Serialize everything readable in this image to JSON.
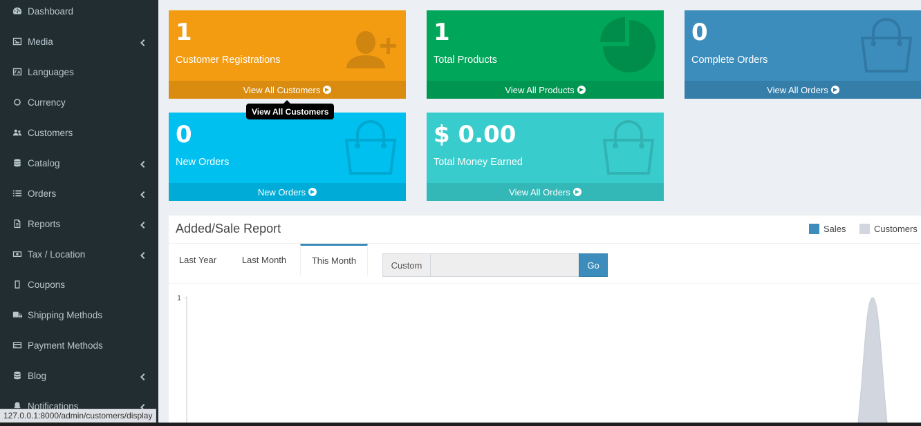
{
  "sidebar": {
    "items": [
      {
        "label": "Dashboard",
        "icon": "dashboard-icon",
        "has_submenu": false
      },
      {
        "label": "Media",
        "icon": "image-icon",
        "has_submenu": true
      },
      {
        "label": "Languages",
        "icon": "language-icon",
        "has_submenu": false
      },
      {
        "label": "Currency",
        "icon": "circle-icon",
        "has_submenu": false
      },
      {
        "label": "Customers",
        "icon": "users-icon",
        "has_submenu": false
      },
      {
        "label": "Catalog",
        "icon": "database-icon",
        "has_submenu": true
      },
      {
        "label": "Orders",
        "icon": "list-icon",
        "has_submenu": true
      },
      {
        "label": "Reports",
        "icon": "file-icon",
        "has_submenu": true
      },
      {
        "label": "Tax / Location",
        "icon": "money-icon",
        "has_submenu": true
      },
      {
        "label": "Coupons",
        "icon": "tablet-icon",
        "has_submenu": false
      },
      {
        "label": "Shipping Methods",
        "icon": "truck-icon",
        "has_submenu": false
      },
      {
        "label": "Payment Methods",
        "icon": "credit-card-icon",
        "has_submenu": false
      },
      {
        "label": "Blog",
        "icon": "database-icon",
        "has_submenu": true
      },
      {
        "label": "Notifications",
        "icon": "bell-icon",
        "has_submenu": true
      }
    ]
  },
  "tiles": [
    {
      "value": "1",
      "caption": "Customer Registrations",
      "link": "View All Customers",
      "color": "#f39c12",
      "icon": "user-plus-icon"
    },
    {
      "value": "1",
      "caption": "Total Products",
      "link": "View All Products",
      "color": "#00a65a",
      "icon": "pie-chart-icon"
    },
    {
      "value": "0",
      "caption": "Complete Orders",
      "link": "View All Orders",
      "color": "#3c8dbc",
      "icon": "shopping-bag-icon"
    },
    {
      "value": "0",
      "caption": "New Orders",
      "link": "New Orders",
      "color": "#00c0ef",
      "icon": "shopping-bag-icon"
    },
    {
      "value": "$ 0.00",
      "caption": "Total Money Earned",
      "link": "View All Orders",
      "color": "#39cccc",
      "icon": "shopping-bag-icon"
    }
  ],
  "tooltip": "View All Customers",
  "report": {
    "title": "Added/Sale Report",
    "legend": [
      {
        "label": "Sales",
        "color": "#3c8dbc"
      },
      {
        "label": "Customers",
        "color": "#d2d6de"
      }
    ],
    "tabs": [
      {
        "label": "Last Year",
        "active": false
      },
      {
        "label": "Last Month",
        "active": false
      },
      {
        "label": "This Month",
        "active": true
      }
    ],
    "custom_label": "Custom",
    "custom_value": "",
    "go_label": "Go"
  },
  "chart_data": {
    "type": "area",
    "series": [
      {
        "name": "Sales",
        "color": "#3c8dbc"
      },
      {
        "name": "Customers",
        "color": "#d2d6de"
      }
    ],
    "y_ticks": [
      "1"
    ],
    "ylim": [
      0,
      1
    ]
  },
  "status_url": "127.0.0.1:8000/admin/customers/display"
}
